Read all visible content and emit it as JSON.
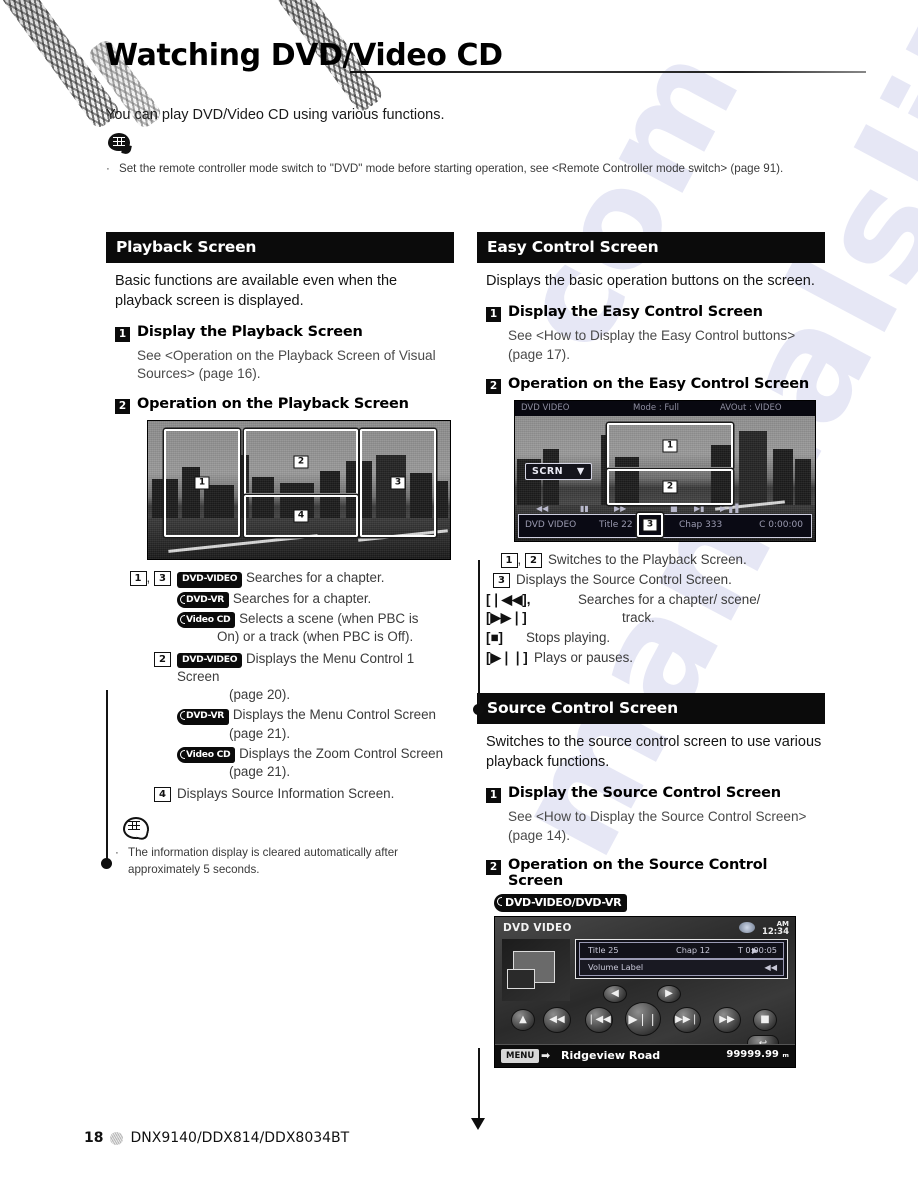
{
  "header": {
    "title": "Watching DVD/Video CD",
    "intro": "You can play DVD/Video CD using various functions.",
    "note_bullet": "·",
    "note_text": "Set the remote controller mode switch to \"DVD\" mode before starting operation, see <Remote Controller mode switch> (page 91)."
  },
  "left": {
    "panel": {
      "heading": "Playback Screen",
      "lead": "Basic functions are available even when the playback screen is displayed.",
      "step1_num": "1",
      "step1_label": "Display the Playback Screen",
      "step1_sub": "See <Operation on the Playback Screen of Visual Sources> (page 16).",
      "step2_num": "2",
      "step2_label": "Operation on the Playback Screen"
    },
    "figure": {
      "name": "playback-screen",
      "zones": [
        "1",
        "2",
        "3",
        "4"
      ]
    },
    "legend": [
      {
        "key_a": "1",
        "key_sep": ",",
        "key_b": "3",
        "badge": "DVD-VIDEO",
        "text": "Searches for a chapter."
      },
      {
        "badge": "DVD-VR",
        "badge_disc": true,
        "text": "Searches for a chapter."
      },
      {
        "badge": "Video CD",
        "badge_disc": true,
        "text": "Selects a scene (when PBC is",
        "cont": "On) or a track (when PBC is Off)."
      },
      {
        "key_a": "2",
        "badge": "DVD-VIDEO",
        "text": "Displays the Menu Control 1 Screen",
        "cont": "(page 20)."
      },
      {
        "badge": "DVD-VR",
        "badge_disc": true,
        "text": "Displays the Menu Control Screen",
        "cont": "(page 21)."
      },
      {
        "badge": "Video CD",
        "badge_disc": true,
        "text": "Displays the Zoom Control Screen",
        "cont": "(page 21)."
      },
      {
        "key_a": "4",
        "text": "Displays Source Information Screen."
      }
    ],
    "note": {
      "bullet": "·",
      "text": "The information display is cleared automatically after approximately 5 seconds."
    }
  },
  "right": {
    "easy": {
      "heading": "Easy Control Screen",
      "lead": "Displays the basic operation buttons on the screen.",
      "step1_num": "1",
      "step1_label": "Display the Easy Control Screen",
      "step1_sub": "See <How to Display the Easy Control buttons> (page 17).",
      "step2_num": "2",
      "step2_label": "Operation on the Easy Control Screen"
    },
    "easy_figure": {
      "name": "easy-control-screen",
      "osd_source": "DVD VIDEO",
      "osd_mode": "Mode : Full",
      "osd_avout": "AVOut : VIDEO",
      "scrn_button": "SCRN",
      "scrn_caret": "▼",
      "transport": [
        "◀◀",
        "▮▮",
        "▶▶",
        "■",
        "▶▮",
        "▶▐▐"
      ],
      "status_source": "DVD VIDEO",
      "status_title": "Title 22",
      "status_chap": "Chap 333",
      "status_time": "C  0:00:00",
      "zones": [
        "1",
        "2",
        "3"
      ]
    },
    "easy_legend": [
      {
        "key_a": "1",
        "key_sep": ",",
        "key_b": "2",
        "text": "Switches to the Playback Screen."
      },
      {
        "key_a": "3",
        "text": "Displays the Source Control Screen."
      },
      {
        "sym": "[❘◀◀], [▶▶❘]",
        "text": "Searches for a chapter/ scene/",
        "cont": "track."
      },
      {
        "sym": "[■]",
        "text": "Stops playing."
      },
      {
        "sym": "[▶❘❘]",
        "text": "Plays or pauses."
      }
    ],
    "source": {
      "heading": "Source Control Screen",
      "lead": "Switches to the source control screen to use various playback functions.",
      "step1_num": "1",
      "step1_label": "Display the Source Control Screen",
      "step1_sub": "See <How to Display the Source Control Screen> (page 14).",
      "step2_num": "2",
      "step2_label": "Operation on the Source Control Screen",
      "disc_caption": "DVD-VIDEO/DVD-VR"
    },
    "source_figure": {
      "name": "source-control-screen",
      "title": "DVD VIDEO",
      "clock_ampm": "AM",
      "clock_time": "12:34",
      "info_title": "Title  25",
      "info_chap": "Chap  12",
      "info_play": "▶",
      "info_time": "T  0:00:05",
      "info_volume": "Volume Label",
      "buttons": [
        "▲",
        "◀◀",
        "❘◀◀",
        "▶❘❘",
        "▶▶❘",
        "▶▶",
        "■",
        "◀",
        "▶",
        "↩"
      ],
      "menu_label": "MENU",
      "nav_arrow": "➡",
      "road_name": "Ridgeview Road",
      "distance": "99999.99 ₘ"
    }
  },
  "footer": {
    "page": "18",
    "models": "DNX9140/DDX814/DDX8034BT"
  }
}
